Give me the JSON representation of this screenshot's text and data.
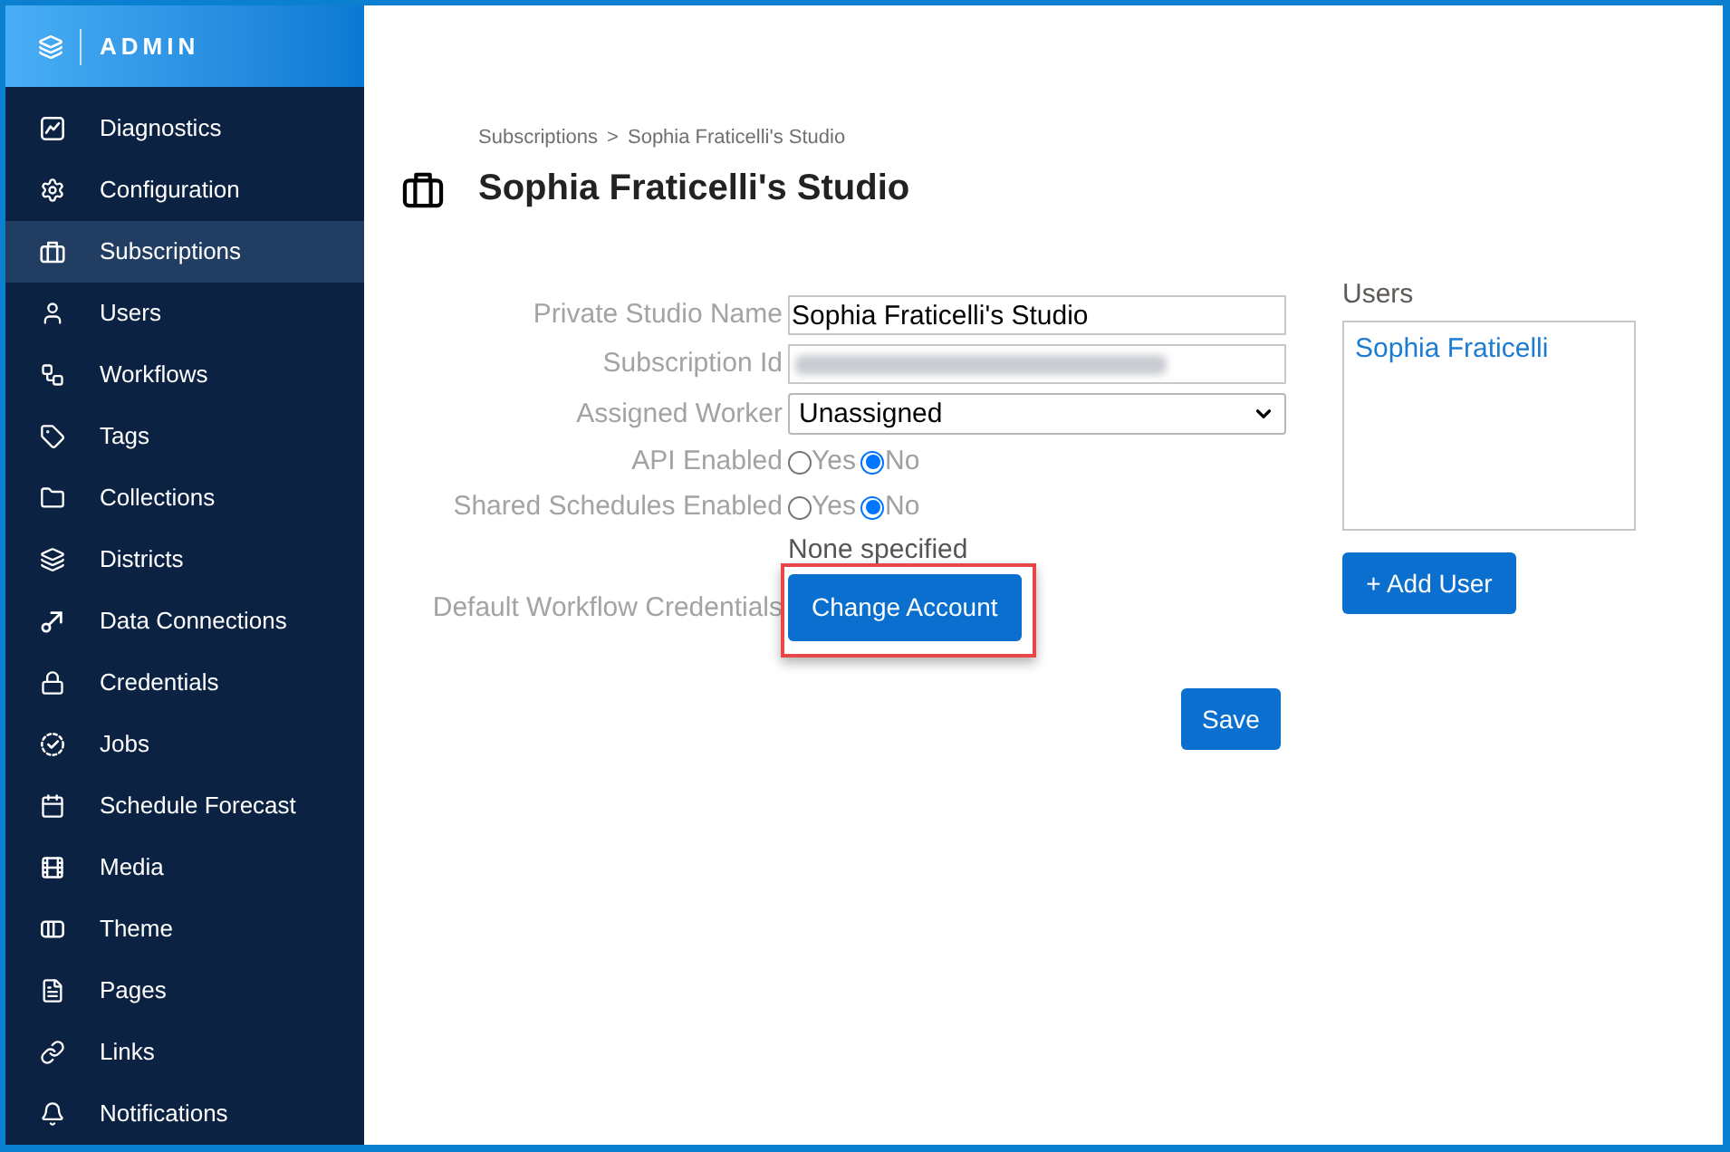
{
  "sidebar": {
    "brand": "ADMIN",
    "items": [
      {
        "label": "Diagnostics",
        "selected": false
      },
      {
        "label": "Configuration",
        "selected": false
      },
      {
        "label": "Subscriptions",
        "selected": true
      },
      {
        "label": "Users",
        "selected": false
      },
      {
        "label": "Workflows",
        "selected": false
      },
      {
        "label": "Tags",
        "selected": false
      },
      {
        "label": "Collections",
        "selected": false
      },
      {
        "label": "Districts",
        "selected": false
      },
      {
        "label": "Data Connections",
        "selected": false
      },
      {
        "label": "Credentials",
        "selected": false
      },
      {
        "label": "Jobs",
        "selected": false
      },
      {
        "label": "Schedule Forecast",
        "selected": false
      },
      {
        "label": "Media",
        "selected": false
      },
      {
        "label": "Theme",
        "selected": false
      },
      {
        "label": "Pages",
        "selected": false
      },
      {
        "label": "Links",
        "selected": false
      },
      {
        "label": "Notifications",
        "selected": false
      }
    ]
  },
  "breadcrumb": {
    "items": [
      "Subscriptions",
      "Sophia Fraticelli's Studio"
    ],
    "separator": ">"
  },
  "page_title": "Sophia Fraticelli's Studio",
  "form": {
    "fields": [
      {
        "kind": "text",
        "label": "Private Studio Name",
        "value": "Sophia Fraticelli's Studio"
      },
      {
        "kind": "redacted",
        "label": "Subscription Id"
      },
      {
        "kind": "select",
        "label": "Assigned Worker",
        "value": "Unassigned"
      },
      {
        "kind": "radio",
        "label": "API Enabled",
        "options": [
          {
            "label": "Yes",
            "selected": false
          },
          {
            "label": "No",
            "selected": true
          }
        ]
      },
      {
        "kind": "radio",
        "label": "Shared Schedules Enabled",
        "options": [
          {
            "label": "Yes",
            "selected": false
          },
          {
            "label": "No",
            "selected": true
          }
        ]
      },
      {
        "kind": "account",
        "label": "Default Workflow Credentials",
        "status": "None specified",
        "button": "Change Account",
        "highlighted": true
      }
    ],
    "save_button": "Save"
  },
  "users": {
    "label": "Users",
    "items": [
      "Sophia Fraticelli"
    ],
    "add_button": "+ Add User"
  }
}
